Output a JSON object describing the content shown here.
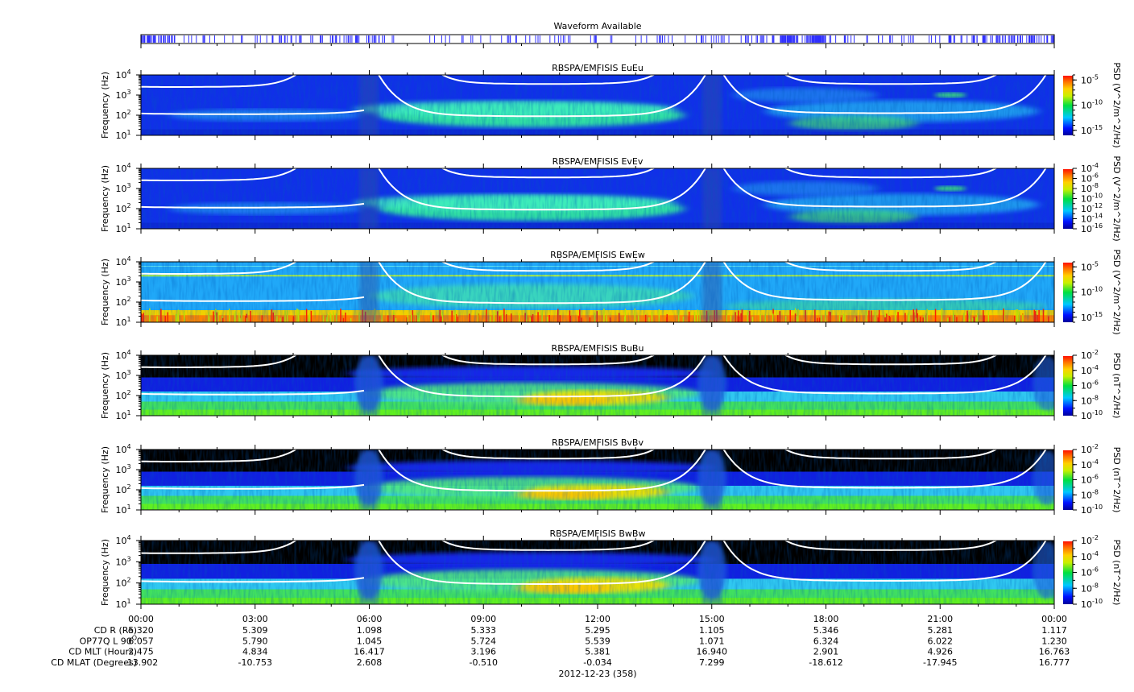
{
  "chart_data": {
    "type": "heatmap",
    "waveform_title": "Waveform Available",
    "date_label": "2012-12-23 (358)",
    "x_ticks": [
      "00:00",
      "03:00",
      "06:00",
      "09:00",
      "12:00",
      "15:00",
      "18:00",
      "21:00",
      "00:00"
    ],
    "x_range_hours": [
      0,
      24
    ],
    "y_axis": {
      "label": "Frequency (Hz)",
      "base": "10",
      "exponents": [
        "1",
        "2",
        "3",
        "4"
      ],
      "range": [
        10,
        10000
      ],
      "scale": "log"
    },
    "panels": [
      {
        "title": "RBSPA/EMFISIS  EuEu",
        "kind": "E",
        "cbar_label": "PSD (V^2/m^2/Hz)",
        "cbar_ticks": [
          "-5",
          "-10",
          "-15"
        ],
        "cbar_range_exp": [
          -16,
          -4
        ]
      },
      {
        "title": "RBSPA/EMFISIS  EvEv",
        "kind": "E",
        "cbar_label": "PSD (V^2/m^2/Hz)",
        "cbar_ticks": [
          "-4",
          "-6",
          "-8",
          "-10",
          "-12",
          "-14",
          "-16"
        ],
        "cbar_range_exp": [
          -16,
          -4
        ]
      },
      {
        "title": "RBSPA/EMFISIS  EwEw",
        "kind": "Ew",
        "cbar_label": "PSD (V^2/m^2/Hz)",
        "cbar_ticks": [
          "-5",
          "-10",
          "-15"
        ],
        "cbar_range_exp": [
          -16,
          -4
        ]
      },
      {
        "title": "RBSPA/EMFISIS  BuBu",
        "kind": "B",
        "cbar_label": "PSD (nT^2/Hz)",
        "cbar_ticks": [
          "-2",
          "-4",
          "-6",
          "-8",
          "-10"
        ],
        "cbar_range_exp": [
          -10,
          -2
        ]
      },
      {
        "title": "RBSPA/EMFISIS  BvBv",
        "kind": "B",
        "cbar_label": "PSD (nT^2/Hz)",
        "cbar_ticks": [
          "-2",
          "-4",
          "-6",
          "-8",
          "-10"
        ],
        "cbar_range_exp": [
          -10,
          -2
        ]
      },
      {
        "title": "RBSPA/EMFISIS  BwBw",
        "kind": "B",
        "cbar_label": "PSD (nT^2/Hz)",
        "cbar_ticks": [
          "-2",
          "-4",
          "-6",
          "-8",
          "-10"
        ],
        "cbar_range_exp": [
          -10,
          -2
        ]
      }
    ],
    "ephemeris": [
      {
        "label": "CD R (Re)",
        "values": [
          "5.320",
          "5.309",
          "1.098",
          "5.333",
          "5.295",
          "1.105",
          "5.346",
          "5.281",
          "1.117"
        ]
      },
      {
        "label": "OP77Q L 90",
        "sup": "O",
        "values": [
          "6.057",
          "5.790",
          "1.045",
          "5.724",
          "5.539",
          "1.071",
          "6.324",
          "6.022",
          "1.230"
        ]
      },
      {
        "label": "CD MLT (Hours)",
        "values": [
          "2.475",
          "4.834",
          "16.417",
          "3.196",
          "5.381",
          "16.940",
          "2.901",
          "4.926",
          "16.763"
        ]
      },
      {
        "label": "CD MLAT (Degrees)",
        "values": [
          "-13.902",
          "-10.753",
          "2.608",
          "-0.510",
          "-0.034",
          "7.299",
          "-18.612",
          "-17.945",
          "16.777"
        ]
      }
    ],
    "colors": {
      "waveform": "#3030ff",
      "curve": "#ffffff"
    }
  }
}
